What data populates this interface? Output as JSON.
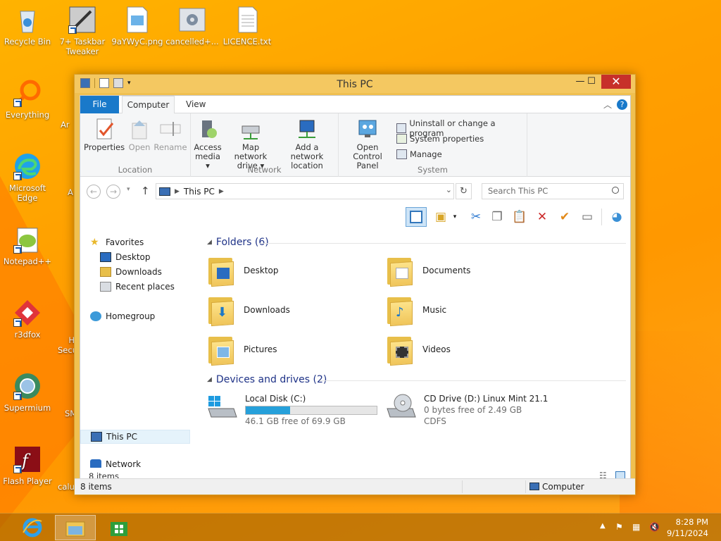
{
  "desktop": {
    "icons": [
      {
        "label": "Recycle Bin"
      },
      {
        "label": "7+ Taskbar Tweaker"
      },
      {
        "label": "9aYWyC.png"
      },
      {
        "label": "cancelled+..."
      },
      {
        "label": "LICENCE.txt"
      },
      {
        "label": "Everything"
      },
      {
        "label": "Microsoft Edge"
      },
      {
        "label": "Notepad++"
      },
      {
        "label": "r3dfox"
      },
      {
        "label": "Supermium"
      },
      {
        "label": "Flash Player"
      }
    ],
    "partial_labels": [
      "Ar",
      "A",
      "H Secu",
      "SM",
      "calu"
    ]
  },
  "window": {
    "title": "This PC",
    "ribbon_tabs": [
      "File",
      "Computer",
      "View"
    ],
    "groups": {
      "location": {
        "label": "Location",
        "buttons": [
          "Properties",
          "Open",
          "Rename"
        ]
      },
      "network": {
        "label": "Network",
        "buttons": [
          {
            "line1": "Access",
            "line2": "media ▾"
          },
          {
            "line1": "Map network",
            "line2": "drive ▾"
          },
          {
            "line1": "Add a network",
            "line2": "location"
          }
        ]
      },
      "system": {
        "label": "System",
        "big_button": {
          "line1": "Open Control",
          "line2": "Panel"
        },
        "small_buttons": [
          "Uninstall or change a program",
          "System properties",
          "Manage"
        ]
      }
    },
    "address": {
      "crumb": "This PC",
      "search_placeholder": "Search This PC"
    },
    "navpane": {
      "favorites": "Favorites",
      "favorites_items": [
        "Desktop",
        "Downloads",
        "Recent places"
      ],
      "homegroup": "Homegroup",
      "this_pc": "This PC",
      "network": "Network"
    },
    "folders_title": "Folders (6)",
    "folders": [
      "Desktop",
      "Documents",
      "Downloads",
      "Music",
      "Pictures",
      "Videos"
    ],
    "drives_title": "Devices and drives (2)",
    "drives": [
      {
        "name": "Local Disk (C:)",
        "free": "46.1 GB free of 69.9 GB",
        "used_fraction": 0.34
      },
      {
        "name": "CD Drive (D:) Linux Mint 21.1",
        "free": "0 bytes free of 2.49 GB",
        "fs": "CDFS"
      }
    ],
    "inner_status": "8 items",
    "status_left": "8 items",
    "status_right": "Computer"
  },
  "taskbar": {
    "time": "8:28 PM",
    "date": "9/11/2024"
  }
}
